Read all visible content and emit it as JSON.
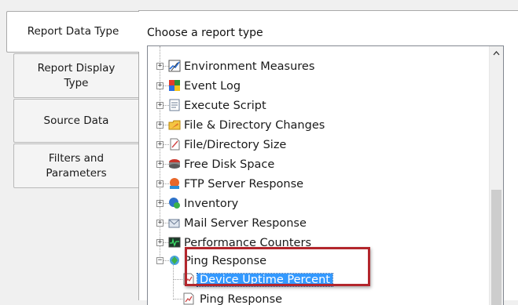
{
  "tabs": [
    {
      "label": "Report Data Type",
      "active": true
    },
    {
      "label": "Report Display Type",
      "active": false
    },
    {
      "label": "Source Data",
      "active": false
    },
    {
      "label": "Filters and Parameters",
      "active": false
    }
  ],
  "pane_label": "Choose a report type",
  "tree": {
    "items": [
      {
        "label": "Environment Measures",
        "icon": "environment-icon"
      },
      {
        "label": "Event Log",
        "icon": "event-log-icon"
      },
      {
        "label": "Execute Script",
        "icon": "script-icon"
      },
      {
        "label": "File & Directory Changes",
        "icon": "folder-changes-icon"
      },
      {
        "label": "File/Directory Size",
        "icon": "file-size-icon"
      },
      {
        "label": "Free Disk Space",
        "icon": "disk-icon"
      },
      {
        "label": "FTP Server Response",
        "icon": "ftp-icon"
      },
      {
        "label": "Inventory",
        "icon": "inventory-icon"
      },
      {
        "label": "Mail Server Response",
        "icon": "mail-icon"
      },
      {
        "label": "Performance Counters",
        "icon": "performance-icon"
      },
      {
        "label": "Ping Response",
        "icon": "ping-icon"
      }
    ],
    "children": [
      {
        "label": "Device Uptime Percent",
        "selected": true,
        "icon": "report-icon"
      },
      {
        "label": "Ping Response",
        "selected": false,
        "icon": "report-icon"
      }
    ]
  },
  "colors": {
    "selection": "#3399ff",
    "highlight_box": "#b3262c"
  }
}
